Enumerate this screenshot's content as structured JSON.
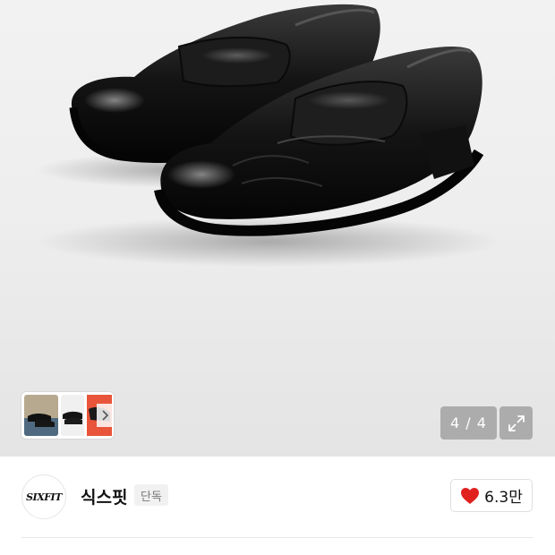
{
  "product_image": {
    "alt_icon": "loafer-shoes-photo",
    "current_index": 4,
    "total": 4,
    "counter_text": "4 / 4",
    "thumbnails": [
      "thumb-shoes-on-feet",
      "thumb-shoes-pair",
      "thumb-shoe-orange"
    ]
  },
  "shop": {
    "logo_text": "SIXFIT",
    "name": "식스핏",
    "badge": "단독"
  },
  "like": {
    "count": "6.3만",
    "heart_color": "#e0211e"
  }
}
